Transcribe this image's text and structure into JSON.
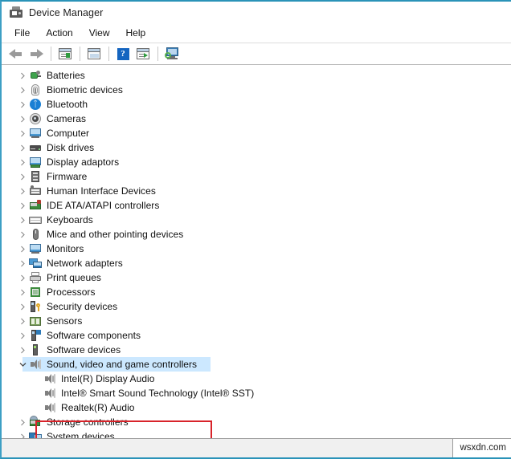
{
  "window": {
    "title": "Device Manager",
    "icon": "device-manager-icon"
  },
  "menubar": {
    "items": [
      {
        "label": "File"
      },
      {
        "label": "Action"
      },
      {
        "label": "View"
      },
      {
        "label": "Help"
      }
    ]
  },
  "toolbar": {
    "buttons": [
      {
        "name": "back-button",
        "icon": "back-arrow-icon"
      },
      {
        "name": "forward-button",
        "icon": "forward-arrow-icon"
      },
      {
        "name": "properties-button",
        "icon": "properties-window-icon"
      },
      {
        "name": "show-hidden-button",
        "icon": "list-window-icon"
      },
      {
        "name": "help-button",
        "icon": "help-question-icon"
      },
      {
        "name": "update-driver-button",
        "icon": "window-play-icon"
      },
      {
        "name": "scan-hardware-button",
        "icon": "scan-monitor-icon"
      }
    ]
  },
  "tree": {
    "nodes": [
      {
        "label": "Batteries",
        "icon": "battery-icon",
        "level": 0,
        "expanded": false,
        "selected": false
      },
      {
        "label": "Biometric devices",
        "icon": "fingerprint-icon",
        "level": 0,
        "expanded": false,
        "selected": false
      },
      {
        "label": "Bluetooth",
        "icon": "bluetooth-icon",
        "level": 0,
        "expanded": false,
        "selected": false
      },
      {
        "label": "Cameras",
        "icon": "camera-icon",
        "level": 0,
        "expanded": false,
        "selected": false
      },
      {
        "label": "Computer",
        "icon": "computer-monitor-icon",
        "level": 0,
        "expanded": false,
        "selected": false
      },
      {
        "label": "Disk drives",
        "icon": "disk-drive-icon",
        "level": 0,
        "expanded": false,
        "selected": false
      },
      {
        "label": "Display adaptors",
        "icon": "display-adapter-icon",
        "level": 0,
        "expanded": false,
        "selected": false
      },
      {
        "label": "Firmware",
        "icon": "firmware-chip-icon",
        "level": 0,
        "expanded": false,
        "selected": false
      },
      {
        "label": "Human Interface Devices",
        "icon": "hid-icon",
        "level": 0,
        "expanded": false,
        "selected": false
      },
      {
        "label": "IDE ATA/ATAPI controllers",
        "icon": "ide-controller-icon",
        "level": 0,
        "expanded": false,
        "selected": false
      },
      {
        "label": "Keyboards",
        "icon": "keyboard-icon",
        "level": 0,
        "expanded": false,
        "selected": false
      },
      {
        "label": "Mice and other pointing devices",
        "icon": "mouse-icon",
        "level": 0,
        "expanded": false,
        "selected": false
      },
      {
        "label": "Monitors",
        "icon": "monitor-icon",
        "level": 0,
        "expanded": false,
        "selected": false
      },
      {
        "label": "Network adapters",
        "icon": "network-adapter-icon",
        "level": 0,
        "expanded": false,
        "selected": false
      },
      {
        "label": "Print queues",
        "icon": "printer-icon",
        "level": 0,
        "expanded": false,
        "selected": false
      },
      {
        "label": "Processors",
        "icon": "processor-icon",
        "level": 0,
        "expanded": false,
        "selected": false
      },
      {
        "label": "Security devices",
        "icon": "security-device-icon",
        "level": 0,
        "expanded": false,
        "selected": false
      },
      {
        "label": "Sensors",
        "icon": "sensor-icon",
        "level": 0,
        "expanded": false,
        "selected": false
      },
      {
        "label": "Software components",
        "icon": "software-component-icon",
        "level": 0,
        "expanded": false,
        "selected": false
      },
      {
        "label": "Software devices",
        "icon": "software-device-icon",
        "level": 0,
        "expanded": false,
        "selected": false
      },
      {
        "label": "Sound, video and game controllers",
        "icon": "speaker-icon",
        "level": 0,
        "expanded": true,
        "selected": true
      },
      {
        "label": "Intel(R) Display Audio",
        "icon": "speaker-icon",
        "level": 1,
        "expanded": null,
        "selected": false
      },
      {
        "label": "Intel® Smart Sound Technology (Intel® SST)",
        "icon": "speaker-icon",
        "level": 1,
        "expanded": null,
        "selected": false
      },
      {
        "label": "Realtek(R) Audio",
        "icon": "speaker-icon",
        "level": 1,
        "expanded": null,
        "selected": false
      },
      {
        "label": "Storage controllers",
        "icon": "storage-controller-icon",
        "level": 0,
        "expanded": false,
        "selected": false
      },
      {
        "label": "System devices",
        "icon": "system-device-icon",
        "level": 0,
        "expanded": false,
        "selected": false
      }
    ]
  },
  "highlight": {
    "name": "red-annotation-box",
    "target_label": "Sound, video and game controllers",
    "color": "#d8232a"
  },
  "selection": {
    "background_color": "#cce8ff"
  },
  "statusbar": {
    "watermark": "wsxdn.com"
  }
}
